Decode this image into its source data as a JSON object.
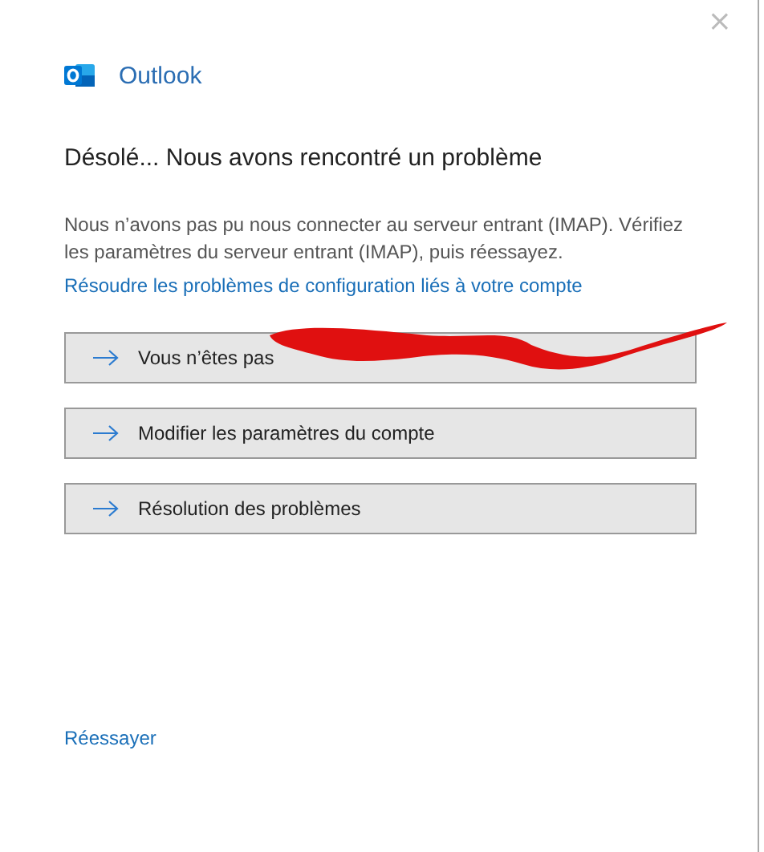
{
  "window": {
    "close": "×"
  },
  "app": {
    "name": "Outlook"
  },
  "heading": "Désolé... Nous avons rencontré un problème",
  "message": "Nous n’avons pas pu nous connecter au serveur entrant (IMAP). Vérifiez les paramètres du serveur entrant (IMAP), puis réessayez.",
  "help_link": "Résoudre les problèmes de configuration liés à votre compte",
  "actions": [
    {
      "label": "Vous n’êtes pas",
      "redacted": true
    },
    {
      "label": "Modifier les paramètres du compte",
      "redacted": false
    },
    {
      "label": "Résolution des problèmes",
      "redacted": false
    }
  ],
  "retry_link": "Réessayer"
}
